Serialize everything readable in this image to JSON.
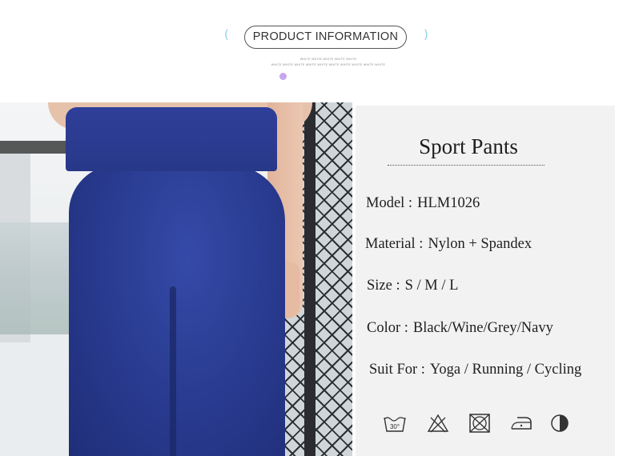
{
  "header": {
    "title": "PRODUCT INFORMATION",
    "bracket_left": "(",
    "bracket_right": ")",
    "fine_print_line1": "WHITE WHITE WHITE WHITE WHITE",
    "fine_print_line2": "WHITE WHITE WHITE WHITE WHITE WHITE WHITE WHITE WHITE WHITE",
    "accent_color": "#c6a6f0"
  },
  "product": {
    "name": "Sport Pants",
    "specs": [
      {
        "label": "Model :",
        "value": "HLM1026"
      },
      {
        "label": "Material :",
        "value": "Nylon + Spandex"
      },
      {
        "label": "Size :",
        "value": "S / M / L"
      },
      {
        "label": "Color :",
        "value": "Black/Wine/Grey/Navy"
      },
      {
        "label": "Suit For :",
        "value": "Yoga / Running / Cycling"
      }
    ],
    "pants_color": "#2a3c92"
  },
  "care_icons": [
    {
      "icon": "wash-30-icon",
      "text": "30°"
    },
    {
      "icon": "no-bleach-icon"
    },
    {
      "icon": "no-tumble-dry-icon"
    },
    {
      "icon": "iron-icon"
    },
    {
      "icon": "dry-clean-icon"
    }
  ]
}
